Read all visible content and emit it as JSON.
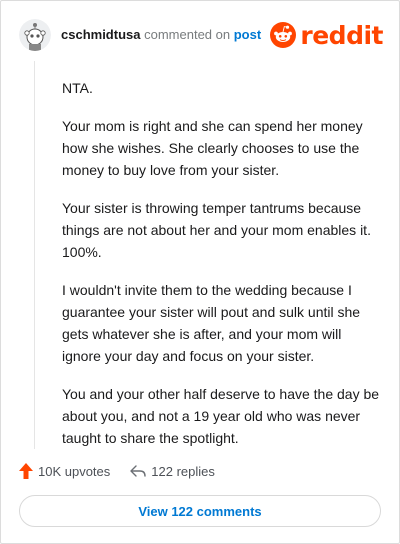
{
  "header": {
    "username": "cschmidtusa",
    "action_text": "commented on",
    "post_link": "post",
    "brand": "reddit"
  },
  "comment": {
    "paragraphs": [
      "NTA.",
      "Your mom is right and she can spend her money how she wishes. She clearly chooses to use the money to buy love from your sister.",
      "Your sister is throwing temper tantrums because things are not about her and your mom enables it. 100%.",
      "I wouldn't invite them to the wedding because I guarantee your sister will pout and sulk until she gets whatever she is after, and your mom will ignore your day and focus on your sister.",
      "You and your other half deserve to have the day be about you, and not a 19 year old who was never taught to share the spotlight."
    ]
  },
  "stats": {
    "upvotes": "10K upvotes",
    "replies": "122 replies"
  },
  "footer": {
    "view_comments": "View 122 comments"
  },
  "colors": {
    "brand": "#ff4500",
    "link": "#0079d3",
    "muted": "#787c7e"
  },
  "icons": {
    "avatar": "snoo-avatar",
    "brand": "reddit-logo-icon",
    "upvote": "upvote-arrow-icon",
    "reply": "reply-arrow-icon"
  }
}
